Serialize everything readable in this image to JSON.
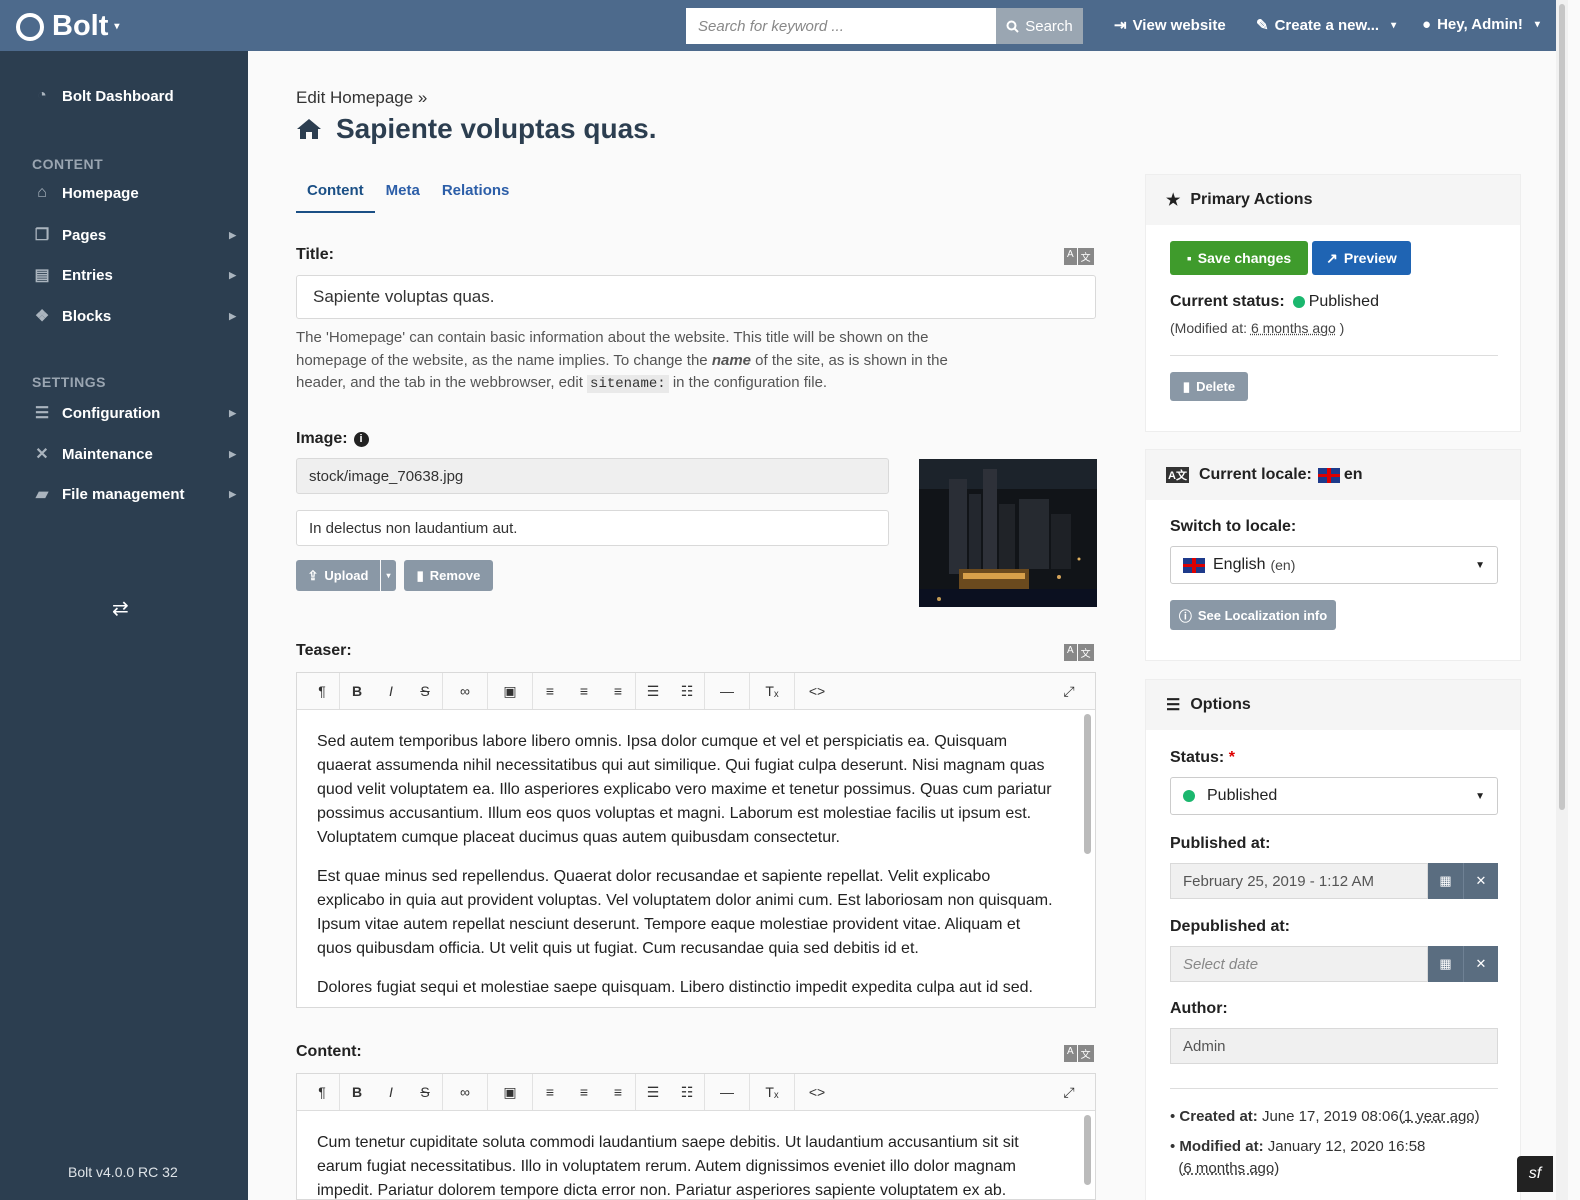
{
  "topbar": {
    "brand": "Bolt",
    "search_placeholder": "Search for keyword ...",
    "search_label": "Search",
    "view_website": "View website",
    "create_new": "Create a new...",
    "user_menu": "Hey, Admin!"
  },
  "sidebar": {
    "dashboard": "Bolt Dashboard",
    "content_heading": "CONTENT",
    "content_items": [
      "Homepage",
      "Pages",
      "Entries",
      "Blocks"
    ],
    "settings_heading": "SETTINGS",
    "settings_items": [
      "Configuration",
      "Maintenance",
      "File management"
    ],
    "version": "Bolt v4.0.0 RC 32"
  },
  "page": {
    "breadcrumb": "Edit Homepage »",
    "title": "Sapiente voluptas quas."
  },
  "tabs": [
    "Content",
    "Meta",
    "Relations"
  ],
  "fields": {
    "title_label": "Title:",
    "title_value": "Sapiente voluptas quas.",
    "help_1": "The 'Homepage' can contain basic information about the website. This title will be shown on the homepage of the website, as the name implies. To change the ",
    "help_name": "name",
    "help_2": " of the site, as is shown in the header, and the tab in the webbrowser, edit ",
    "help_code": "sitename:",
    "help_3": " in the configuration file.",
    "image_label": "Image:",
    "image_path": "stock/image_70638.jpg",
    "image_alt": "In delectus non laudantium aut.",
    "upload": "Upload",
    "remove": "Remove",
    "teaser_label": "Teaser:",
    "teaser_paragraphs": [
      "Sed autem temporibus labore libero omnis. Ipsa dolor cumque et vel et perspiciatis ea. Quisquam quaerat assumenda nihil necessitatibus qui aut similique. Qui fugiat culpa deserunt. Nisi magnam quas quod velit voluptatem ea. Illo asperiores explicabo vero maxime et tenetur possimus. Quas cum pariatur possimus accusantium. Illum eos quos voluptas et magni. Laborum est molestiae facilis ut ipsum est. Voluptatem cumque placeat ducimus quas autem quibusdam consectetur.",
      "Est quae minus sed repellendus. Quaerat dolor recusandae et sapiente repellat. Velit explicabo explicabo in quia aut provident voluptas. Vel voluptatem dolor animi cum. Est laboriosam non quisquam. Ipsum vitae autem repellat nesciunt deserunt. Tempore eaque molestiae provident vitae. Aliquam et quos quibusdam officia. Ut velit quis ut fugiat. Cum recusandae quia sed debitis id et.",
      "Dolores fugiat sequi et molestiae saepe quisquam. Libero distinctio impedit expedita culpa aut id sed."
    ],
    "content_label": "Content:",
    "content_paragraphs": [
      "Cum tenetur cupiditate soluta commodi laudantium saepe debitis. Ut laudantium accusantium sit sit earum fugiat necessitatibus. Illo in voluptatem rerum. Autem dignissimos eveniet illo dolor magnam impedit. Pariatur dolorem tempore dicta error non. Pariatur asperiores sapiente voluptatem ex ab."
    ]
  },
  "primary_actions": {
    "heading": "Primary Actions",
    "save": "Save changes",
    "preview": "Preview",
    "status_label": "Current status:",
    "status_value": "Published",
    "modified_prefix": "(Modified at: ",
    "modified_value": "6 months ago",
    "modified_suffix": " )",
    "delete": "Delete"
  },
  "locale": {
    "heading": "Current locale:",
    "code": "en",
    "switch_label": "Switch to locale:",
    "selected": "English",
    "selected_code": "(en)",
    "info_button": "See Localization info"
  },
  "options": {
    "heading": "Options",
    "status_label": "Status:",
    "required_mark": "*",
    "status_value": "Published",
    "published_label": "Published at:",
    "published_value": "February 25, 2019 - 1:12 AM",
    "depublished_label": "Depublished at:",
    "depublished_placeholder": "Select date",
    "author_label": "Author:",
    "author_value": "Admin",
    "created_label": "Created at:",
    "created_value": "June 17, 2019 08:06",
    "created_rel": "1 year ago",
    "modified_label": "Modified at:",
    "modified_value": "January 12, 2020 16:58",
    "modified_rel": "6 months ago"
  },
  "colors": {
    "topbar": "#4d6a8c",
    "sidebar": "#2c3e50",
    "save": "#3f9b2c",
    "preview": "#1f64b3",
    "published": "#1bb76e"
  }
}
